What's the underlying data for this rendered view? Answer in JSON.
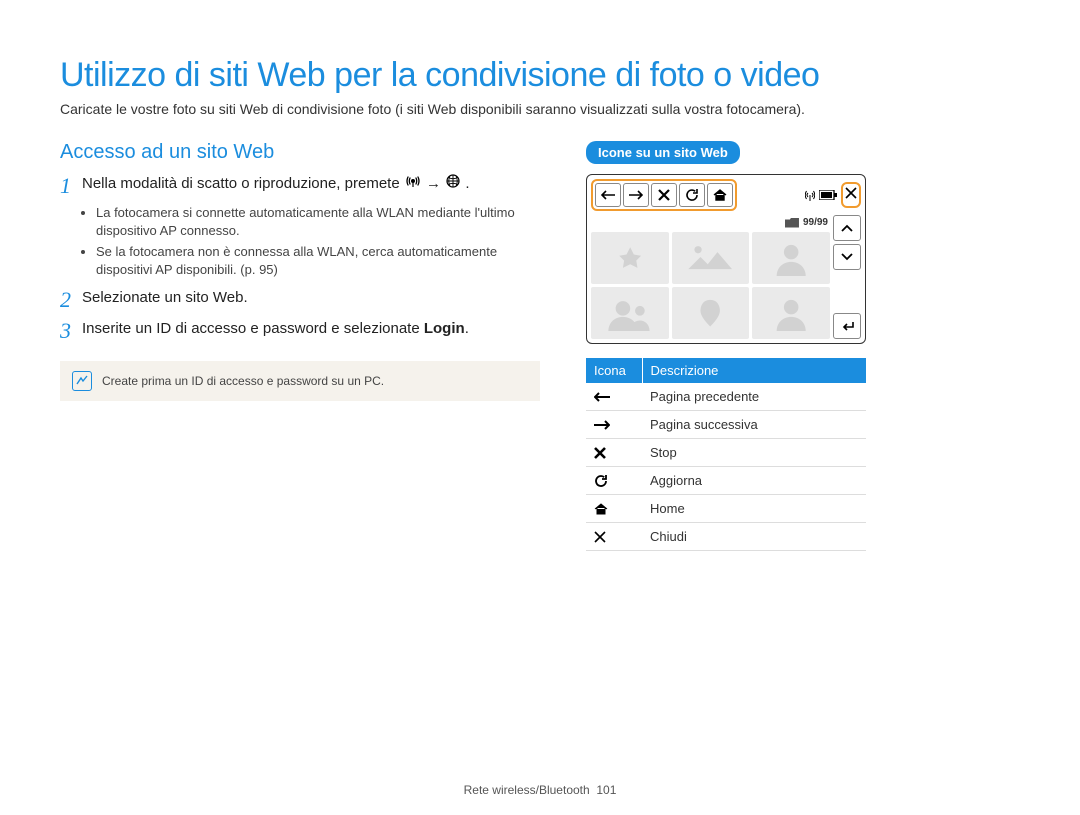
{
  "page_title": "Utilizzo di siti Web per la condivisione di foto o video",
  "intro": "Caricate le vostre foto su siti Web di condivisione foto (i siti Web disponibili saranno visualizzati sulla vostra fotocamera).",
  "left": {
    "heading": "Accesso ad un sito Web",
    "steps": [
      {
        "num": "1",
        "text_a": "Nella modalità di scatto o riproduzione, premete ",
        "text_sep": " → ",
        "text_end": ".",
        "bullets": [
          "La fotocamera si connette automaticamente alla WLAN mediante l'ultimo dispositivo AP connesso.",
          "Se la fotocamera non è connessa alla WLAN, cerca automaticamente dispositivi AP disponibili. (p. 95)"
        ]
      },
      {
        "num": "2",
        "text_a": "Selezionate un sito Web.",
        "bullets": []
      },
      {
        "num": "3",
        "text_a": "Inserite un ID di accesso e password e selezionate ",
        "bold_tail": "Login",
        "text_end": ".",
        "bullets": []
      }
    ],
    "note_text": "Create prima un ID di accesso e password su un PC."
  },
  "right": {
    "pill_label": "Icone su un sito Web",
    "camera": {
      "counter": "99/99"
    },
    "table": {
      "headers": {
        "icon": "Icona",
        "desc": "Descrizione"
      },
      "rows": [
        {
          "icon": "arrow-left",
          "desc": "Pagina precedente"
        },
        {
          "icon": "arrow-right",
          "desc": "Pagina successiva"
        },
        {
          "icon": "x-bold",
          "desc": "Stop"
        },
        {
          "icon": "refresh",
          "desc": "Aggiorna"
        },
        {
          "icon": "home",
          "desc": "Home"
        },
        {
          "icon": "x-thin",
          "desc": "Chiudi"
        }
      ]
    }
  },
  "footer": {
    "section": "Rete wireless/Bluetooth",
    "page_no": "101"
  }
}
